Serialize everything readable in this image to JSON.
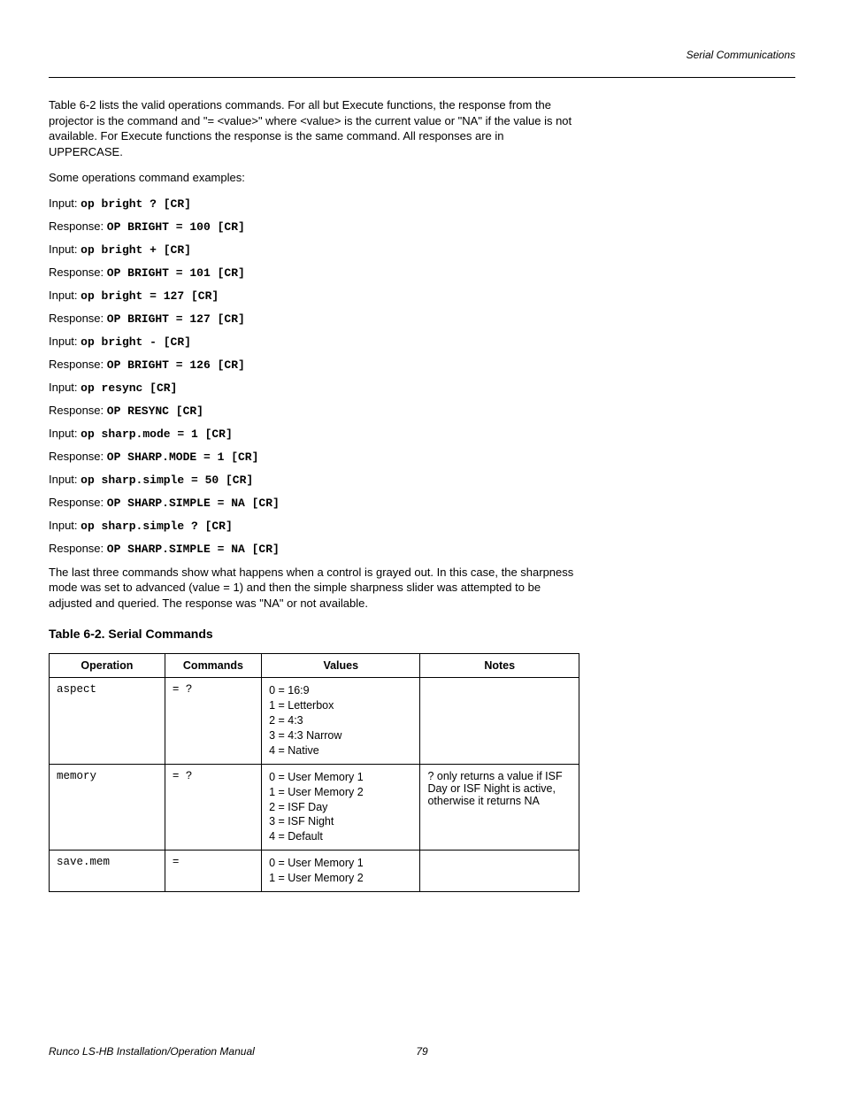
{
  "header": {
    "running": "Serial Communications"
  },
  "intro": {
    "p1": "Table 6-2 lists the valid operations commands. For all but Execute functions, the response from the projector is the command and \"= <value>\" where <value> is the current value or \"NA\" if the value is not available. For Execute functions the response is the same command.  All responses are in UPPERCASE.",
    "p2": "Some operations command examples:"
  },
  "examples": [
    {
      "label": "Input: ",
      "cmd": "op bright ? [CR]"
    },
    {
      "label": "Response: ",
      "cmd": "OP BRIGHT = 100 [CR]"
    },
    {
      "label": "Input: ",
      "cmd": "op bright + [CR]"
    },
    {
      "label": "Response: ",
      "cmd": "OP BRIGHT = 101 [CR]"
    },
    {
      "label": "Input: ",
      "cmd": "op bright = 127 [CR]"
    },
    {
      "label": "Response: ",
      "cmd": "OP BRIGHT = 127 [CR]"
    },
    {
      "label": "Input: ",
      "cmd": "op bright - [CR]"
    },
    {
      "label": "Response: ",
      "cmd": "OP BRIGHT = 126 [CR]"
    },
    {
      "label": "Input: ",
      "cmd": "op resync [CR]"
    },
    {
      "label": "Response: ",
      "cmd": "OP RESYNC [CR]"
    },
    {
      "label": "Input: ",
      "cmd": "op sharp.mode = 1 [CR]"
    },
    {
      "label": "Response: ",
      "cmd": "OP SHARP.MODE = 1 [CR]"
    },
    {
      "label": "Input: ",
      "cmd": "op sharp.simple = 50 [CR]"
    },
    {
      "label": "Response: ",
      "cmd": "OP SHARP.SIMPLE = NA [CR]"
    },
    {
      "label": "Input: ",
      "cmd": "op sharp.simple ? [CR]"
    },
    {
      "label": "Response: ",
      "cmd": "OP SHARP.SIMPLE = NA [CR]"
    }
  ],
  "outro": {
    "p1": "The last three commands show what happens when a control is grayed out.  In this case, the sharpness mode was set to advanced (value = 1) and then the simple sharpness slider was attempted to be adjusted and queried.  The response was \"NA\" or not available."
  },
  "table": {
    "caption": "Table 6-2. Serial Commands",
    "headers": {
      "operation": "Operation",
      "commands": "Commands",
      "values": "Values",
      "notes": "Notes"
    },
    "rows": [
      {
        "operation": "aspect",
        "commands": "= ?",
        "values": [
          "0 = 16:9",
          "1 = Letterbox",
          "2 = 4:3",
          "3 = 4:3 Narrow",
          "4 = Native"
        ],
        "notes": ""
      },
      {
        "operation": "memory",
        "commands": "= ?",
        "values": [
          "0 = User Memory 1",
          "1 = User Memory 2",
          "2 = ISF Day",
          "3 = ISF Night",
          "4 = Default"
        ],
        "notes": "? only returns a value if ISF Day or ISF Night is active, otherwise it returns NA"
      },
      {
        "operation": "save.mem",
        "commands": "=",
        "values": [
          "0 = User Memory 1",
          "1 = User Memory 2"
        ],
        "notes": ""
      }
    ]
  },
  "footer": {
    "left": "Runco LS-HB Installation/Operation Manual",
    "page": "79"
  }
}
